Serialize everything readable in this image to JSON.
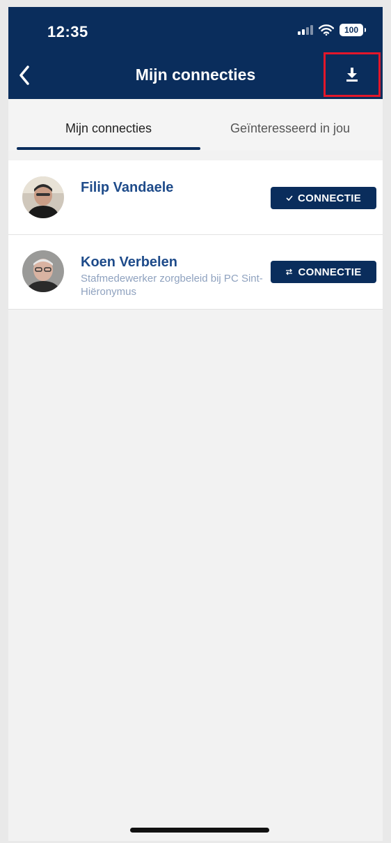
{
  "status_bar": {
    "time": "12:35",
    "battery": "100",
    "signal_icon": "signal-icon",
    "wifi_icon": "wifi-icon"
  },
  "header": {
    "title": "Mijn connecties",
    "back_icon": "chevron-left-icon",
    "download_icon": "download-icon",
    "highlight_color": "#e3172a"
  },
  "tabs": [
    {
      "label": "Mijn connecties",
      "active": true
    },
    {
      "label": "Geïnteresseerd in jou",
      "active": false
    }
  ],
  "connections": [
    {
      "name": "Filip Vandaele",
      "subtitle": "",
      "button_label": "CONNECTIE",
      "button_icon": "check-icon"
    },
    {
      "name": "Koen Verbelen",
      "subtitle": "Stafmedewerker zorgbeleid bij PC Sint-Hiëronymus",
      "button_label": "CONNECTIE",
      "button_icon": "swap-icon"
    }
  ],
  "colors": {
    "brand": "#0a2d5c",
    "name": "#1e4b8a",
    "subtitle": "#8fa2bf"
  }
}
